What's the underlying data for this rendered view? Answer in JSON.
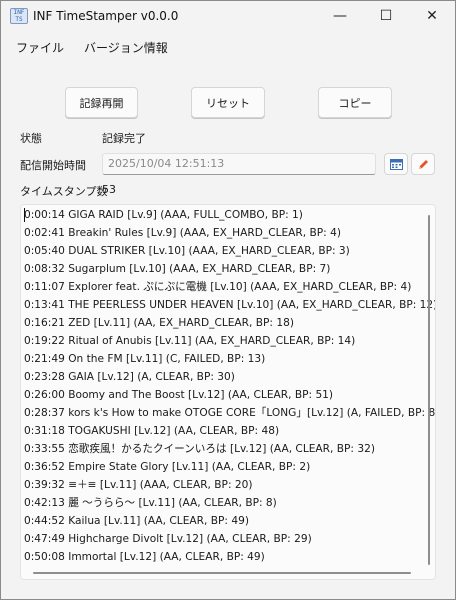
{
  "window": {
    "title": "INF TimeStamper v0.0.0",
    "icon_text": "INF TS",
    "minimize_glyph": "—",
    "maximize_glyph": "☐",
    "close_glyph": "✕"
  },
  "menu": [
    "ファイル",
    "バージョン情報"
  ],
  "toolbar": {
    "resume_label": "記録再開",
    "reset_label": "リセット",
    "copy_label": "コピー"
  },
  "status": {
    "label": "状態",
    "value": "記録完了"
  },
  "stream_start": {
    "label": "配信開始時間",
    "value": "2025/10/04 12:51:13"
  },
  "count": {
    "label": "タイムスタンプ数",
    "value": "53"
  },
  "log_lines": [
    "0:00:14 GIGA RAID [Lv.9] (AAA, FULL_COMBO, BP: 1)",
    "0:02:41 Breakin' Rules [Lv.9] (AAA, EX_HARD_CLEAR, BP: 4)",
    "0:05:40 DUAL STRIKER [Lv.10] (AAA, EX_HARD_CLEAR, BP: 3)",
    "0:08:32 Sugarplum [Lv.10] (AAA, EX_HARD_CLEAR, BP: 7)",
    "0:11:07 Explorer feat. ぷにぷに電機 [Lv.10] (AAA, EX_HARD_CLEAR, BP: 4)",
    "0:13:41 THE PEERLESS UNDER HEAVEN [Lv.10] (AA, EX_HARD_CLEAR, BP: 12)",
    "0:16:21 ZED [Lv.11] (AA, EX_HARD_CLEAR, BP: 18)",
    "0:19:22 Ritual of Anubis [Lv.11] (AA, EX_HARD_CLEAR, BP: 14)",
    "0:21:49 On the FM [Lv.11] (C, FAILED, BP: 13)",
    "0:23:28 GAIA [Lv.12] (A, CLEAR, BP: 30)",
    "0:26:00 Boomy and The Boost [Lv.12] (AA, CLEAR, BP: 51)",
    "0:28:37 kors k's How to make OTOGE CORE「LONG」[Lv.12] (A, FAILED, BP: 8",
    "0:31:18 TOGAKUSHI [Lv.12] (AA, CLEAR, BP: 48)",
    "0:33:55 恋歌疾風！かるたクイーンいろは [Lv.12] (AA, CLEAR, BP: 32)",
    "0:36:52 Empire State Glory [Lv.11] (AA, CLEAR, BP: 2)",
    "0:39:32 ≡＋≡ [Lv.11] (AAA, CLEAR, BP: 20)",
    "0:42:13 麗 〜うらら〜 [Lv.11] (AA, CLEAR, BP: 8)",
    "0:44:52 Kailua [Lv.11] (AA, CLEAR, BP: 49)",
    "0:47:49 Highcharge Divolt [Lv.12] (AA, CLEAR, BP: 29)",
    "0:50:08 Immortal [Lv.12] (AA, CLEAR, BP: 49)"
  ],
  "colors": {
    "pencil": "#e8512a",
    "calendar": "#3a6fb5"
  }
}
